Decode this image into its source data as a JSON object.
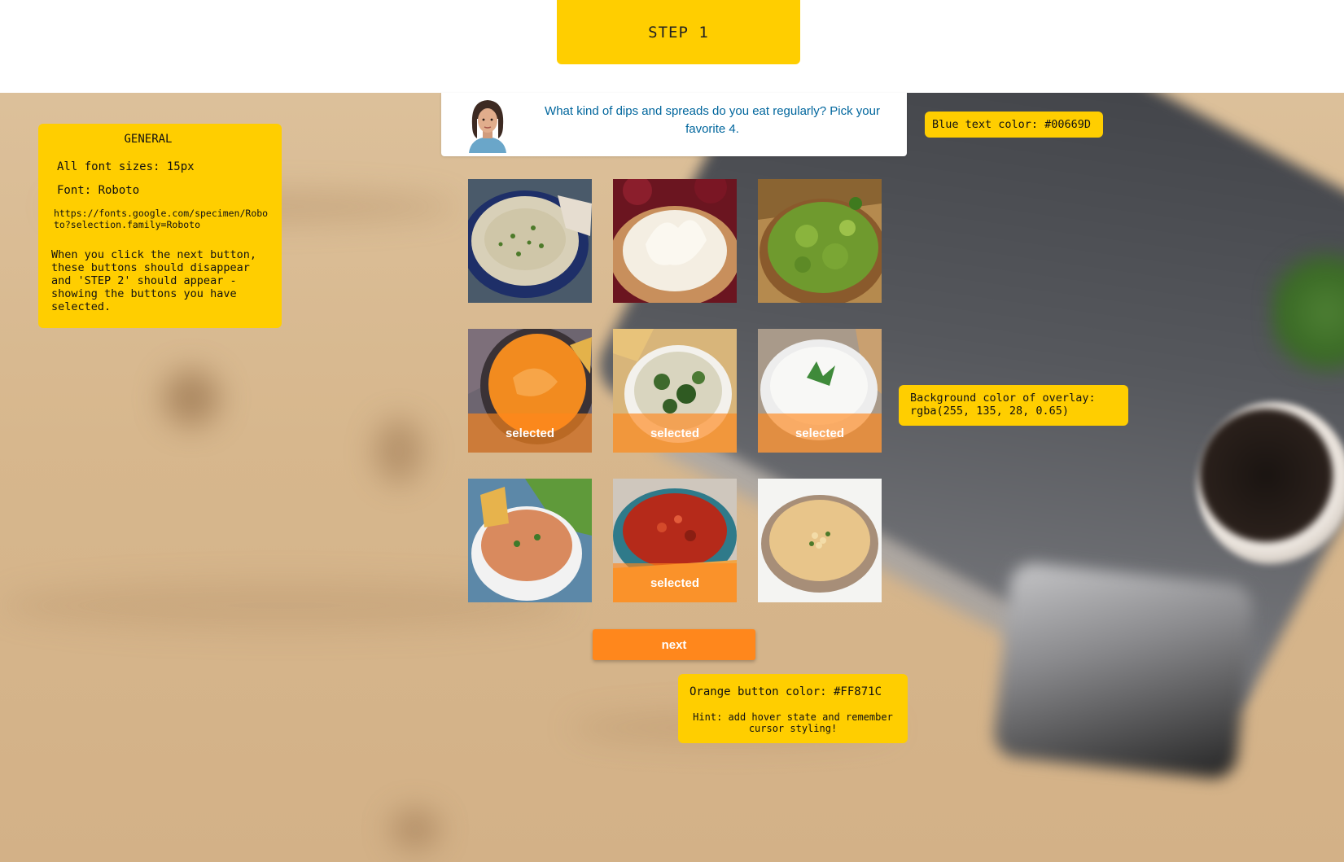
{
  "header": {
    "step_label": "STEP 1"
  },
  "question": {
    "text": "What kind of dips and spreads do you eat regularly? Pick your favorite 4.",
    "avatar_icon": "woman-avatar-icon"
  },
  "tiles": [
    {
      "name": "hummus-dip-tile",
      "selected": false,
      "overlay_label": ""
    },
    {
      "name": "sour-cream-dip-tile",
      "selected": false,
      "overlay_label": ""
    },
    {
      "name": "guacamole-tile",
      "selected": false,
      "overlay_label": ""
    },
    {
      "name": "cheese-dip-tile",
      "selected": true,
      "overlay_label": "selected"
    },
    {
      "name": "spinach-dip-tile",
      "selected": true,
      "overlay_label": "selected"
    },
    {
      "name": "yogurt-dip-tile",
      "selected": true,
      "overlay_label": "selected"
    },
    {
      "name": "buffalo-dip-tile",
      "selected": false,
      "overlay_label": ""
    },
    {
      "name": "salsa-tile",
      "selected": true,
      "overlay_label": "selected"
    },
    {
      "name": "pine-nut-hummus-tile",
      "selected": false,
      "overlay_label": ""
    }
  ],
  "next_button": {
    "label": "next"
  },
  "notes": {
    "general": {
      "title": "GENERAL",
      "font_sizes": "All font sizes: 15px",
      "font": "Font: Roboto",
      "url": "https://fonts.google.com/specimen/Roboto?selection.family=Roboto",
      "instruction": "When you click the next button, these buttons should disappear and 'STEP 2' should appear - showing the buttons you have selected."
    },
    "blue_text": "Blue text color: #00669D",
    "overlay_color": "Background color of overlay: rgba(255, 135, 28, 0.65)",
    "orange_button": "Orange button color: #FF871C",
    "hint": "Hint: add hover state and remember cursor styling!"
  },
  "colors": {
    "yellow": "#FFCE00",
    "blue_text": "#00669D",
    "orange_button": "#FF871C",
    "overlay": "rgba(255, 135, 28, 0.65)"
  }
}
